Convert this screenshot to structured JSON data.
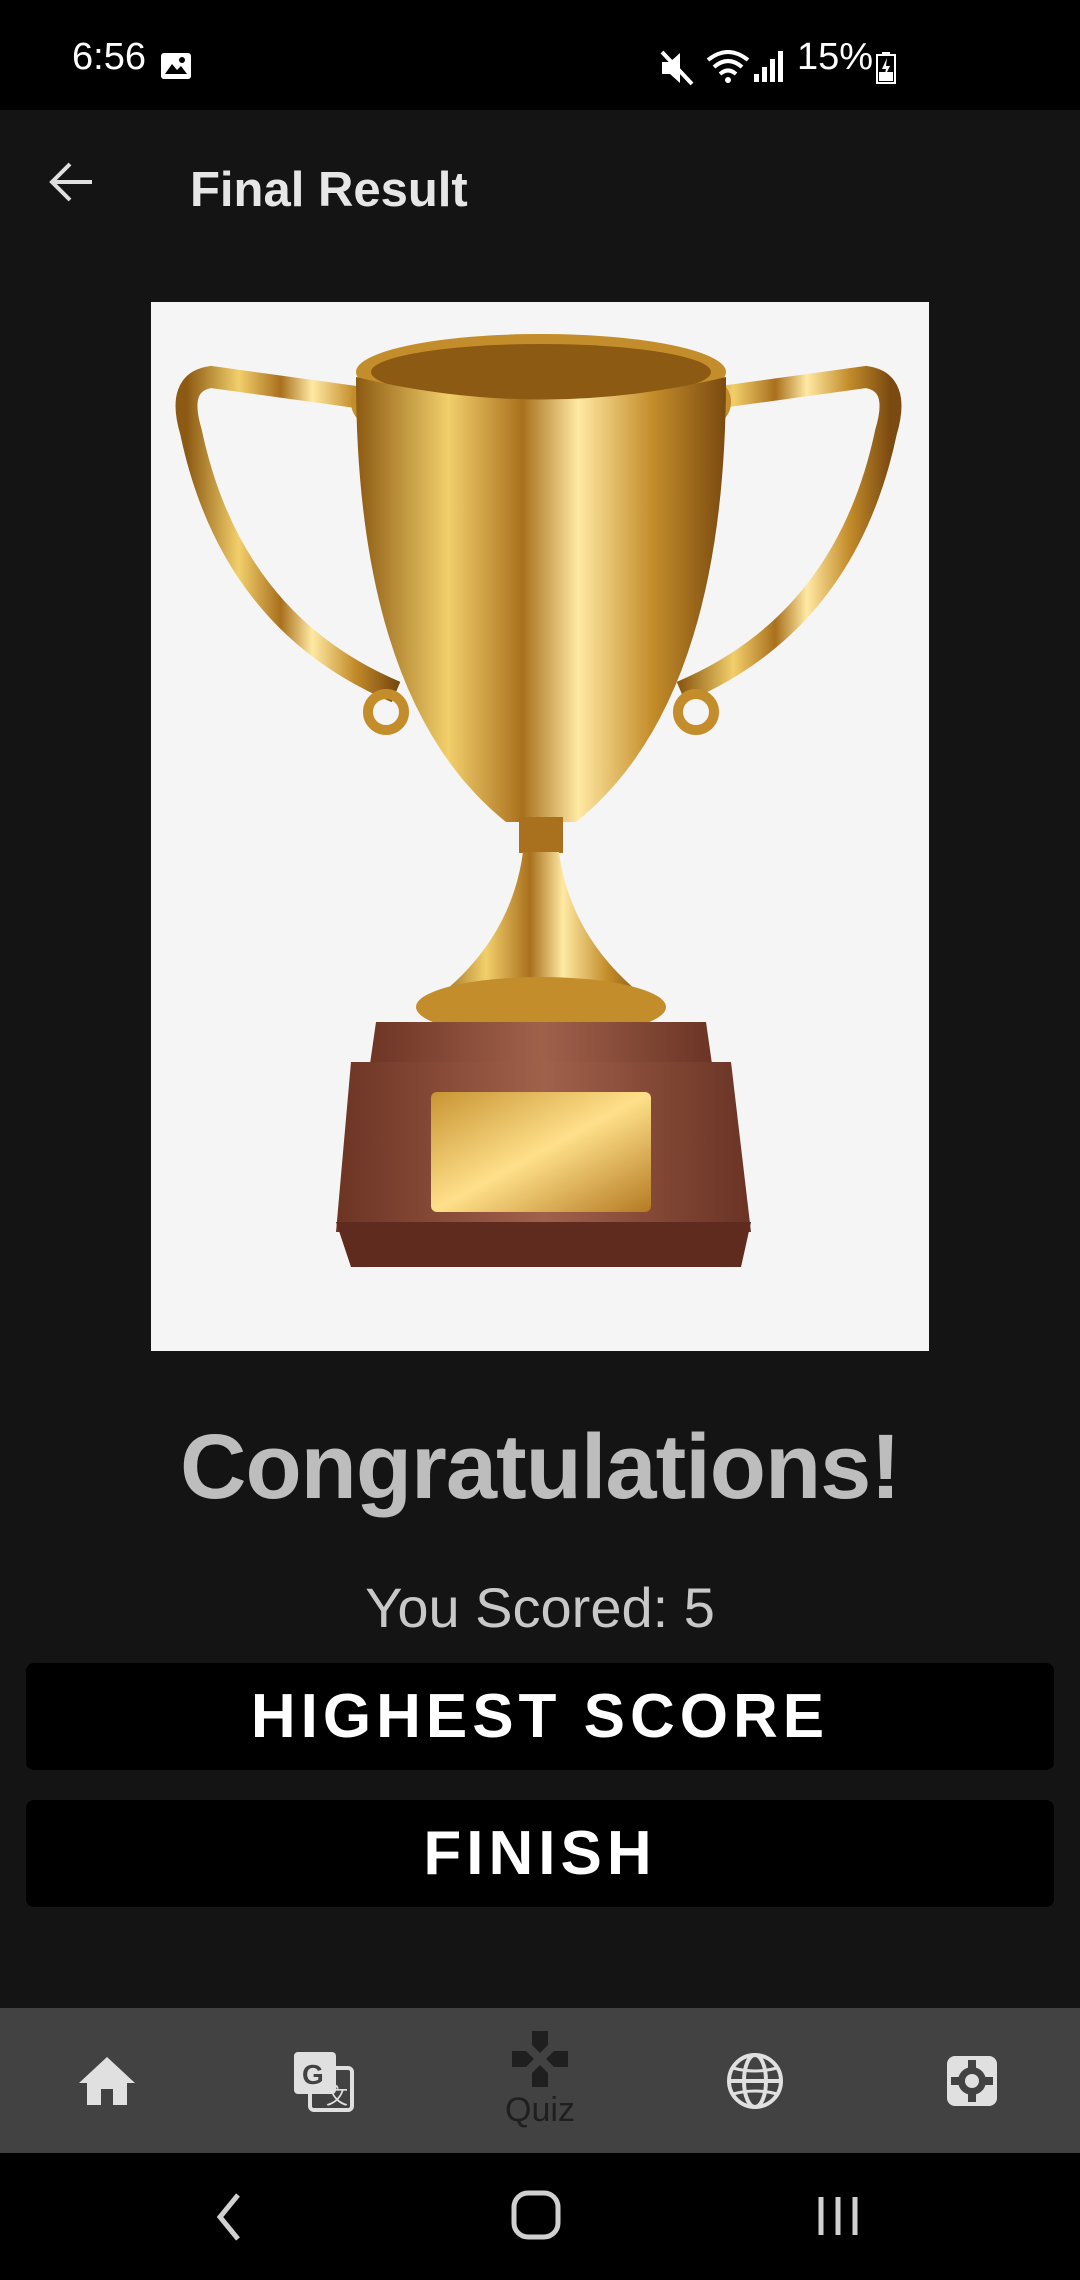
{
  "status_bar": {
    "time": "6:56",
    "battery": "15%"
  },
  "app_bar": {
    "title": "Final Result"
  },
  "result": {
    "heading": "Congratulations!",
    "score_text": "You Scored: 5"
  },
  "buttons": {
    "highest_score": "HIGHEST SCORE",
    "finish": "FINISH"
  },
  "bottom_nav": {
    "items": [
      {
        "icon": "home-icon",
        "label": ""
      },
      {
        "icon": "translate-icon",
        "label": ""
      },
      {
        "icon": "gamepad-icon",
        "label": "Quiz"
      },
      {
        "icon": "globe-icon",
        "label": ""
      },
      {
        "icon": "settings-icon",
        "label": ""
      }
    ],
    "selected": "Quiz"
  },
  "colors": {
    "app_bg": "#141414",
    "nav_bg": "#424242",
    "button_bg": "#000000",
    "trophy_gold": "#d4a23a",
    "trophy_base": "#8a4a36"
  }
}
